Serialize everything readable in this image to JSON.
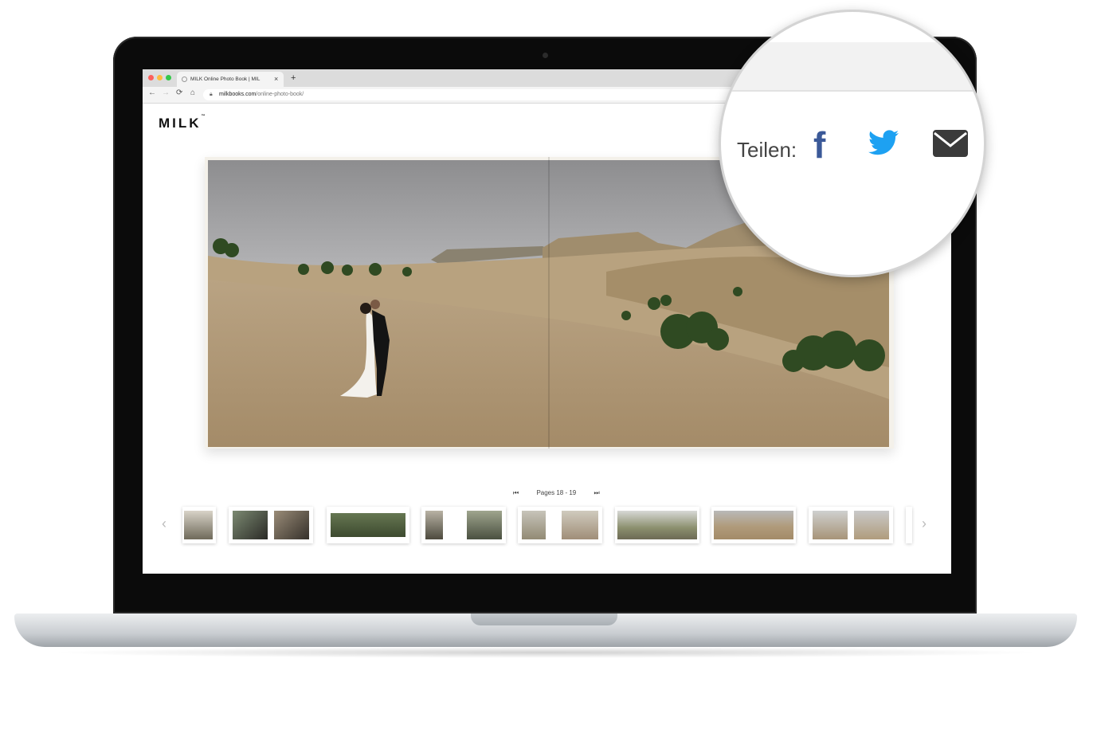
{
  "browser": {
    "tab_title": "MILK Online Photo Book | MIL",
    "tab_close": "×",
    "new_tab": "+",
    "nav": {
      "back": "←",
      "forward": "→",
      "reload": "⟳",
      "home": "⌂"
    },
    "url_domain": "milkbooks.com",
    "url_path": "/online-photo-book/"
  },
  "page": {
    "logo": "MILK",
    "logo_tm": "™",
    "pager": {
      "first": "⏮",
      "label": "Pages 18 - 19",
      "last": "⏭"
    },
    "thumb_prev": "‹",
    "thumb_next": "›"
  },
  "share": {
    "label": "Teilen:",
    "facebook_glyph": "f",
    "icons": [
      "facebook-icon",
      "twitter-icon",
      "mail-icon"
    ],
    "colors": {
      "facebook": "#3b5998",
      "twitter": "#1da1f2",
      "mail": "#3a3a3a"
    }
  }
}
